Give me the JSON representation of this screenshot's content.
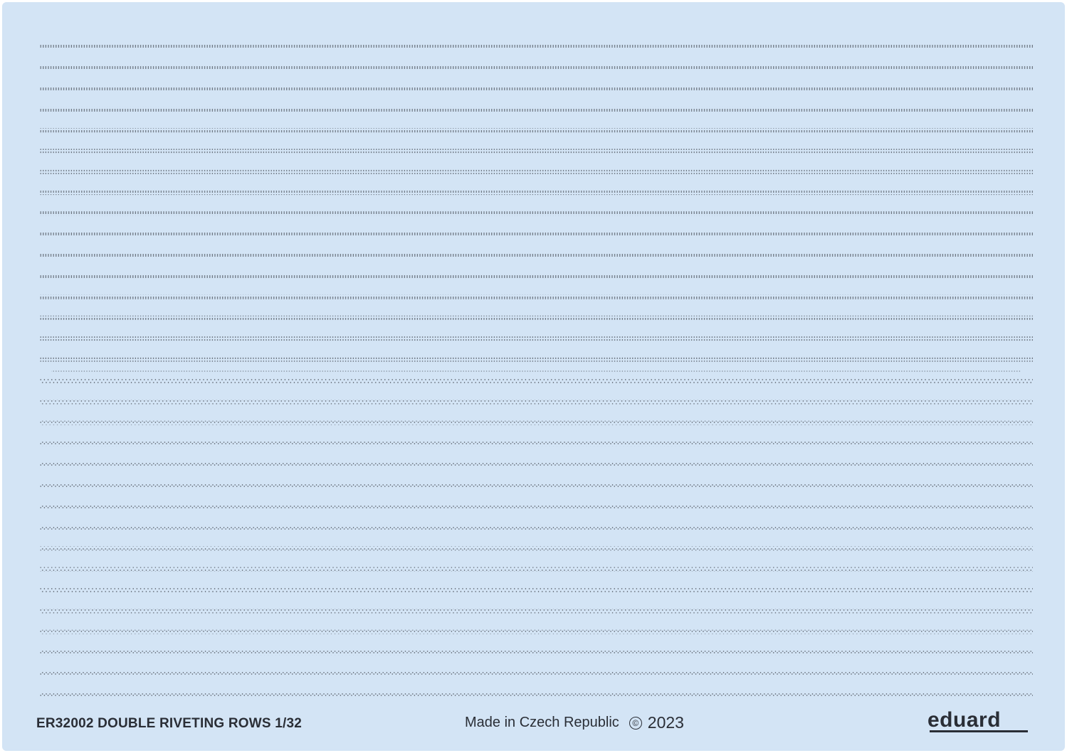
{
  "sheet": {
    "background_color": "#d3e4f5",
    "rivet_color": "#3a3f48",
    "straight_double_rows": 16,
    "staggered_double_rows": 16
  },
  "footer": {
    "product_code": "ER32002 DOUBLE RIVETING ROWS 1/32",
    "origin": "Made in Czech Republic",
    "copyright_symbol": "©",
    "year": "2023",
    "brand": "eduard"
  }
}
